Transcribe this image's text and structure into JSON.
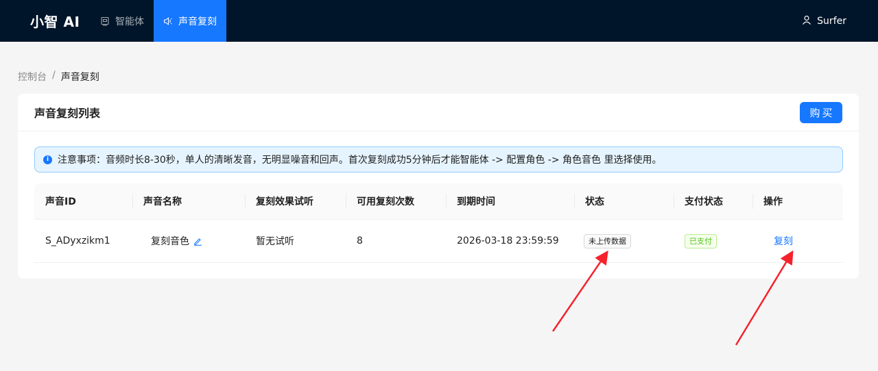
{
  "header": {
    "brand": "小智 AI",
    "nav": [
      {
        "label": "智能体",
        "icon": "robot-icon",
        "active": false
      },
      {
        "label": "声音复刻",
        "icon": "sound-icon",
        "active": true
      }
    ],
    "user": {
      "name": "Surfer",
      "icon": "user-icon"
    }
  },
  "breadcrumb": {
    "root": "控制台",
    "separator": "/",
    "current": "声音复刻"
  },
  "card": {
    "title": "声音复刻列表",
    "buy_label": "购买",
    "notice": "注意事项：音频时长8-30秒，单人的清晰发音，无明显噪音和回声。首次复刻成功5分钟后才能智能体 -> 配置角色 -> 角色音色 里选择使用。"
  },
  "table": {
    "columns": [
      "声音ID",
      "声音名称",
      "复刻效果试听",
      "可用复刻次数",
      "到期时间",
      "状态",
      "支付状态",
      "操作"
    ],
    "rows": [
      {
        "voice_id": "S_ADyxzikm1",
        "voice_name": "复刻音色",
        "preview": "暂无试听",
        "remaining": "8",
        "expire": "2026-03-18 23:59:59",
        "status": "未上传数据",
        "pay_status": "已支付",
        "action": "复刻"
      }
    ]
  },
  "colors": {
    "header_bg": "#001529",
    "primary": "#1677ff",
    "success": "#52c41a",
    "annotation_arrow": "#f5222d"
  }
}
